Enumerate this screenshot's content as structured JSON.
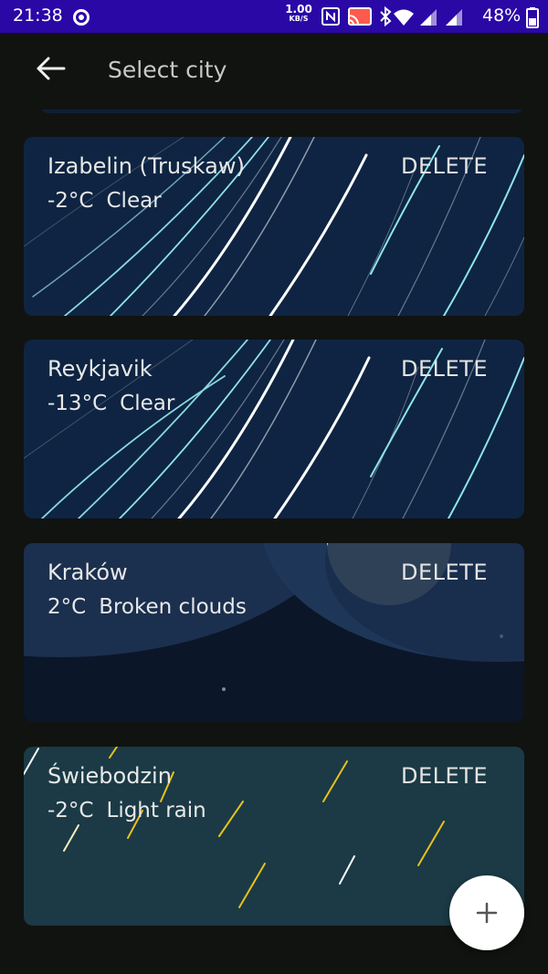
{
  "status_bar": {
    "time": "21:38",
    "net_speed_value": "1.00",
    "net_speed_unit": "KB/S",
    "battery": "48%",
    "background": "#2a08a6",
    "icons": [
      "record-icon",
      "nfc-icon",
      "cast-icon",
      "bluetooth-icon",
      "wifi-icon",
      "signal-icon",
      "signal-icon",
      "battery-icon"
    ]
  },
  "app_bar": {
    "title": "Select city",
    "back_icon": "arrow-left-icon"
  },
  "cities": [
    {
      "name": "Izabelin (Truskaw)",
      "temperature": "-2°C",
      "condition": "Clear",
      "delete_label": "DELETE",
      "scene": "clear-night"
    },
    {
      "name": "Reykjavik",
      "temperature": "-13°C",
      "condition": "Clear",
      "delete_label": "DELETE",
      "scene": "clear-night"
    },
    {
      "name": "Kraków",
      "temperature": "2°C",
      "condition": "Broken clouds",
      "delete_label": "DELETE",
      "scene": "cloudy-night"
    },
    {
      "name": "Świebodzin",
      "temperature": "-2°C",
      "condition": "Light rain",
      "delete_label": "DELETE",
      "scene": "rain"
    }
  ],
  "fab": {
    "icon": "plus-icon"
  },
  "colors": {
    "background": "#111311",
    "clear_night": "#0e2442",
    "cloudy_night": "#0b1628",
    "rain": "#1b3a45",
    "moon": "#f3f7b6"
  }
}
